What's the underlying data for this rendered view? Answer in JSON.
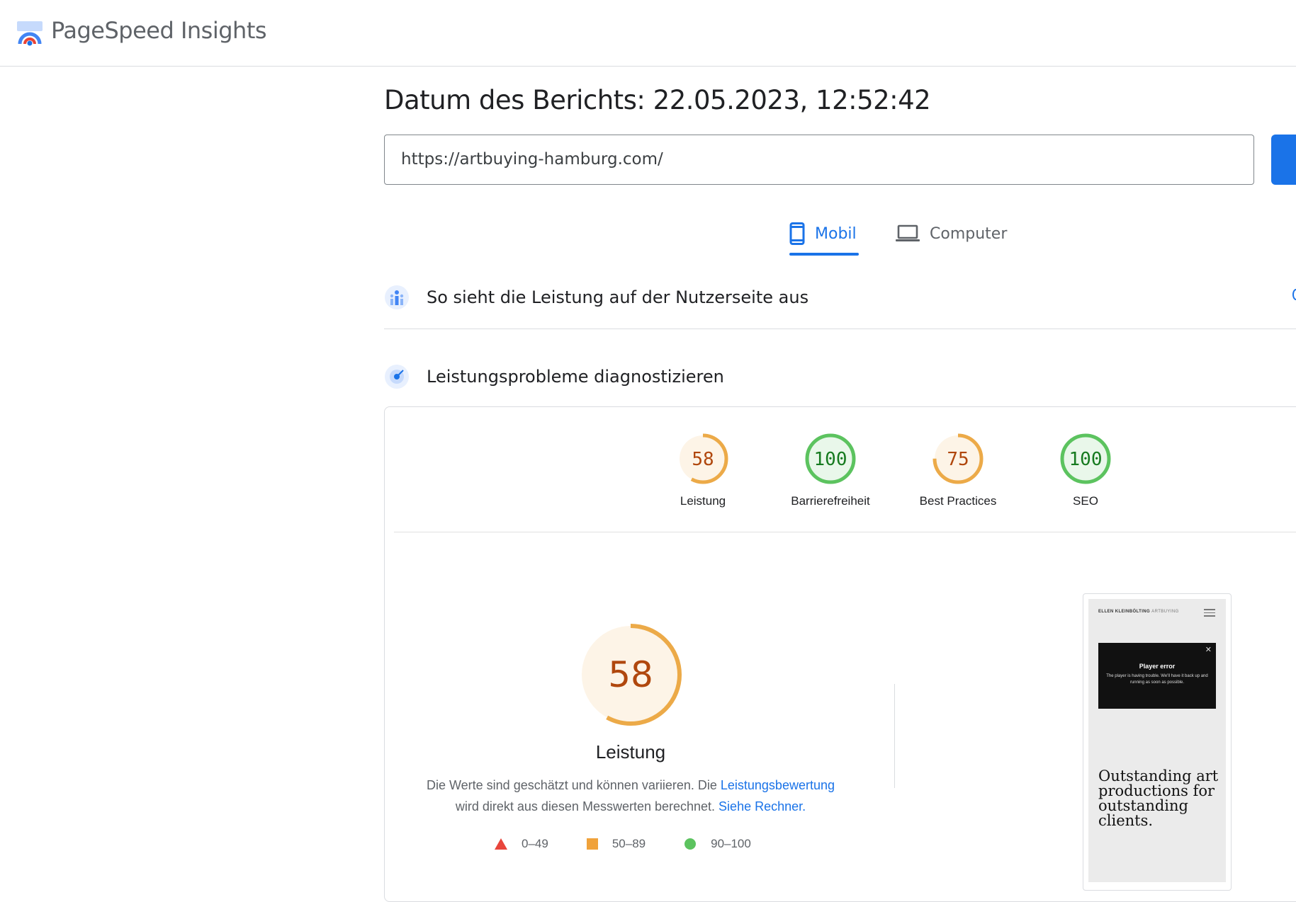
{
  "app": {
    "title": "PageSpeed Insights"
  },
  "report": {
    "date_label": "Datum des Berichts: 22.05.2023, 12:52:42",
    "url": "https://artbuying-hamburg.com/"
  },
  "tabs": [
    {
      "label": "Mobil",
      "active": true,
      "icon": "smartphone-icon"
    },
    {
      "label": "Computer",
      "active": false,
      "icon": "laptop-icon"
    }
  ],
  "sections": {
    "crux_title": "So sieht die Leistung auf der Nutzerseite aus",
    "diagnose_title": "Leistungsprobleme diagnostizieren"
  },
  "scores": [
    {
      "value": "58",
      "label": "Leistung",
      "score": 58,
      "status": "average"
    },
    {
      "value": "100",
      "label": "Barrierefreiheit",
      "score": 100,
      "status": "pass"
    },
    {
      "value": "75",
      "label": "Best Practices",
      "score": 75,
      "status": "average"
    },
    {
      "value": "100",
      "label": "SEO",
      "score": 100,
      "status": "pass"
    }
  ],
  "performance": {
    "score": "58",
    "score_value": 58,
    "label": "Leistung",
    "desc_part1": "Die Werte sind geschätzt und können variieren. Die ",
    "desc_link1": "Leistungsbewertung",
    "desc_part2": "wird direkt aus diesen Messwerten berechnet. ",
    "desc_link2": "Siehe Rechner."
  },
  "legend": [
    {
      "range": "0–49",
      "shape": "triangle",
      "color": "#e8453c"
    },
    {
      "range": "50–89",
      "shape": "square",
      "color": "#f0a23b"
    },
    {
      "range": "90–100",
      "shape": "circle",
      "color": "#5cc35f"
    }
  ],
  "colors": {
    "accent": "#1a73e8",
    "average_stroke": "#ecaa48",
    "average_fill": "#fdf4e7",
    "average_text": "#b0470d",
    "pass_stroke": "#5cc35f",
    "pass_fill": "#e9f7ea",
    "pass_text": "#167a1f"
  },
  "screenshot_preview": {
    "brand_bold": "ELLEN KLEINBÖLTING",
    "brand_light": "ARTBUYING",
    "player_title": "Player error",
    "player_message": "The player is having trouble. We'll have it back up and running as soon as possible.",
    "headline": "Outstanding art productions for outstanding clients."
  }
}
